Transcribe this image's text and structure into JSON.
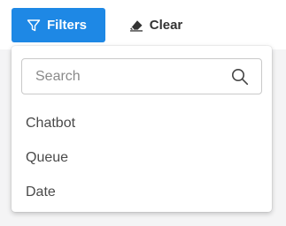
{
  "toolbar": {
    "filters_label": "Filters",
    "clear_label": "Clear"
  },
  "dropdown": {
    "search_placeholder": "Search",
    "options": [
      "Chatbot",
      "Queue",
      "Date"
    ]
  },
  "colors": {
    "accent": "#1e88e5"
  }
}
